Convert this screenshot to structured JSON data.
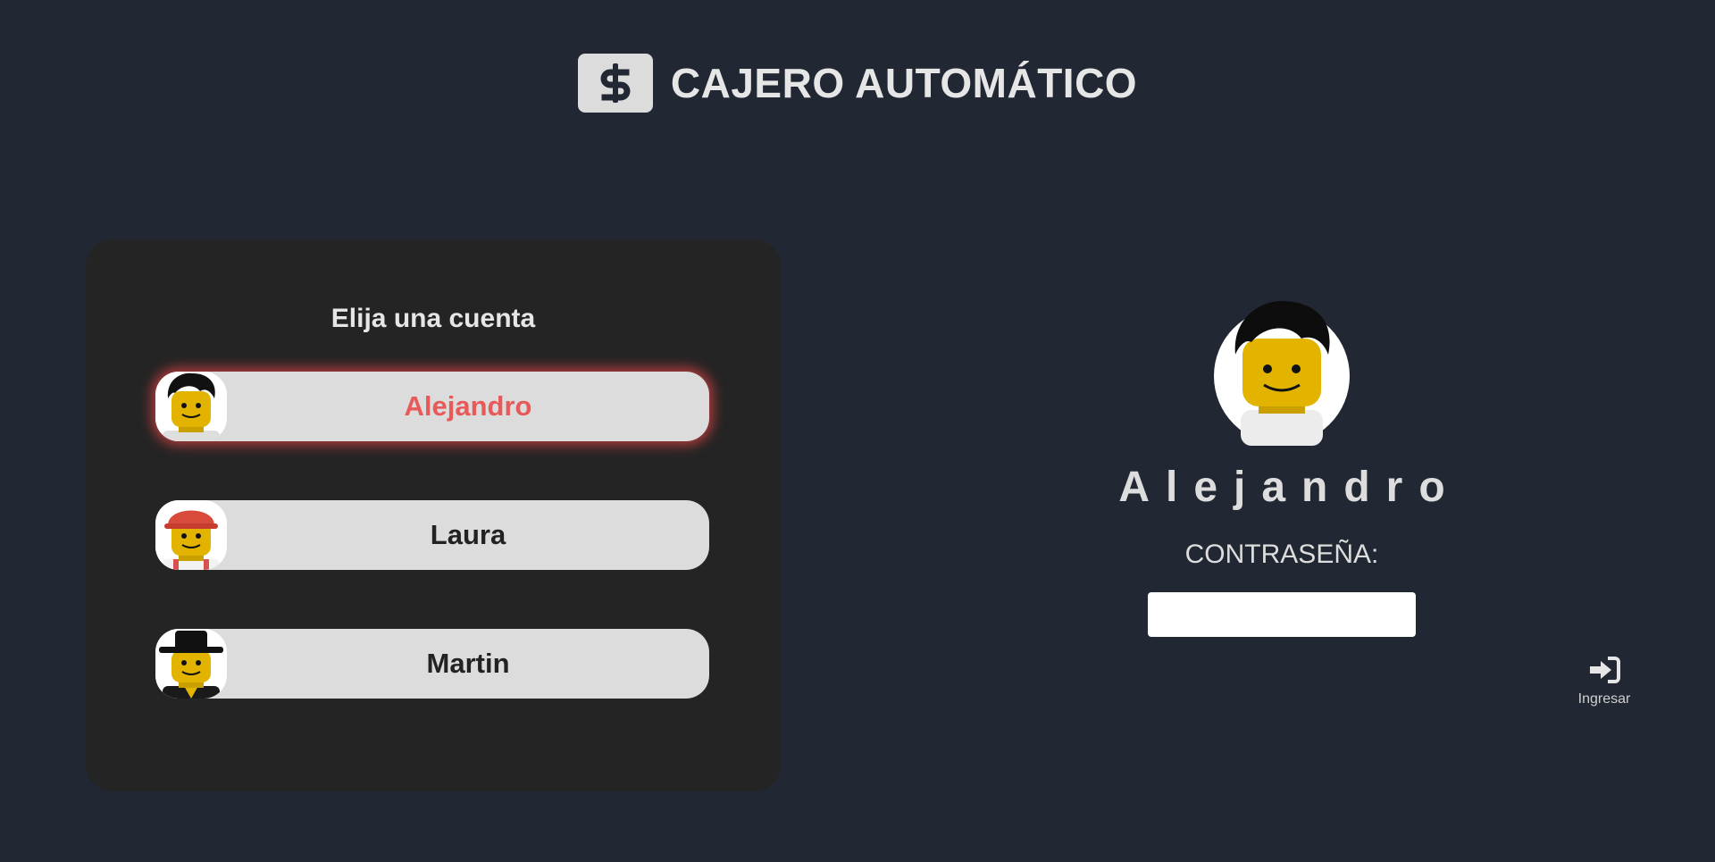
{
  "header": {
    "title": "CAJERO AUTOMÁTICO",
    "logo_icon": "dollar-sign-icon"
  },
  "accounts_panel": {
    "title": "Elija una cuenta",
    "accounts": [
      {
        "name": "Alejandro",
        "avatar": "lego-man-black-hair",
        "selected": true
      },
      {
        "name": "Laura",
        "avatar": "lego-worker-red-helmet",
        "selected": false
      },
      {
        "name": "Martin",
        "avatar": "lego-man-black-hat",
        "selected": false
      }
    ]
  },
  "login": {
    "user_name": "Alejandro",
    "password_label": "CONTRASEÑA:",
    "password_value": "",
    "submit_label": "Ingresar",
    "submit_icon": "sign-in-icon"
  },
  "colors": {
    "background": "#222833",
    "panel": "#242424",
    "card": "#dcdcdc",
    "accent": "#e85a5a"
  }
}
